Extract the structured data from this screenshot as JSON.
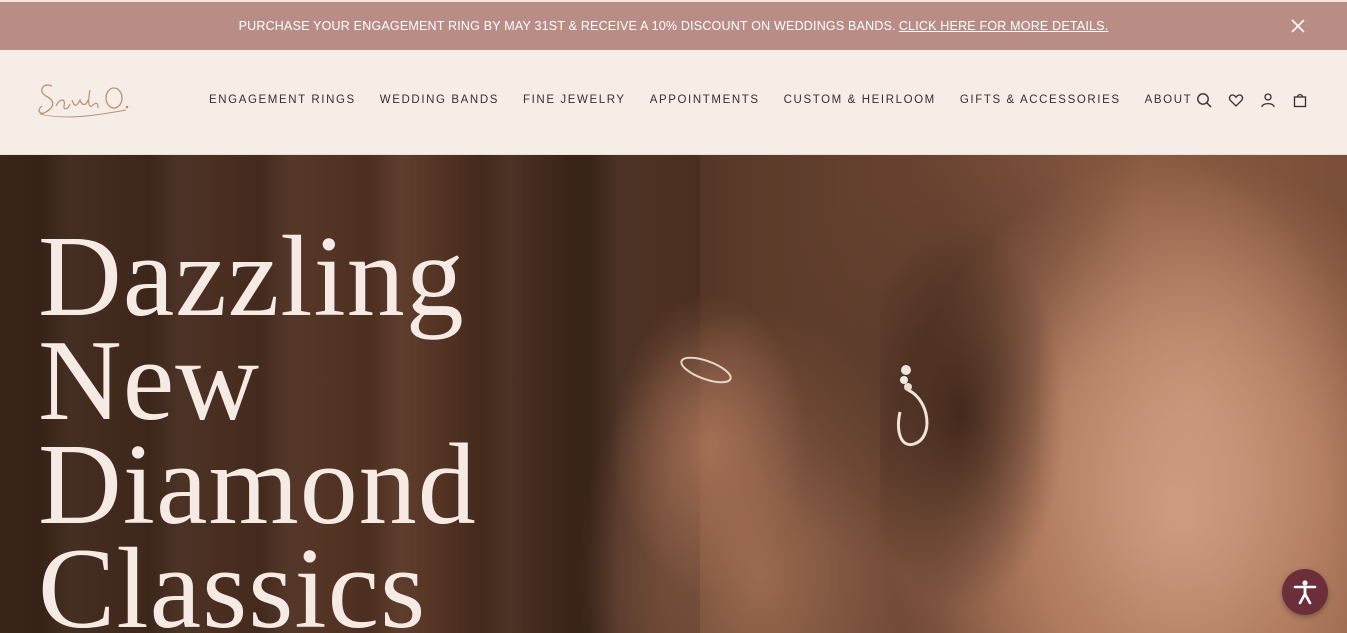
{
  "promo": {
    "message": "PURCHASE YOUR ENGAGEMENT RING BY MAY 31ST & RECEIVE A 10% DISCOUNT ON WEDDINGS BANDS.",
    "link_text": "CLICK HERE FOR MORE DETAILS.",
    "close_icon": "close-icon"
  },
  "header": {
    "logo_text": "Sarah O.",
    "nav": [
      {
        "label": "ENGAGEMENT RINGS"
      },
      {
        "label": "WEDDING BANDS"
      },
      {
        "label": "FINE JEWELRY"
      },
      {
        "label": "APPOINTMENTS"
      },
      {
        "label": "CUSTOM & HEIRLOOM"
      },
      {
        "label": "GIFTS & ACCESSORIES"
      },
      {
        "label": "ABOUT"
      }
    ],
    "icons": [
      "search-icon",
      "heart-icon",
      "account-icon",
      "bag-icon"
    ]
  },
  "hero": {
    "headline_lines": [
      "Dazzling",
      "New",
      "Diamond",
      "Classics"
    ]
  },
  "accessibility": {
    "icon": "accessibility-icon"
  },
  "colors": {
    "promo_bg": "#b98d86",
    "header_bg": "#f7ede7",
    "nav_text": "#3a2f2c",
    "hero_text": "#f6ebe4",
    "accessibility_bg": "#6b2e3a"
  }
}
